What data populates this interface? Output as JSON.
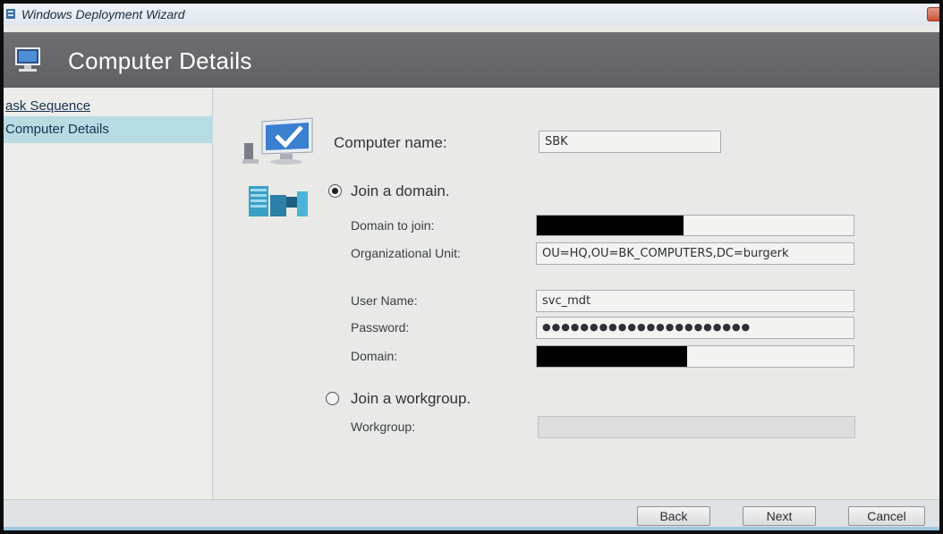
{
  "window": {
    "title": "Windows Deployment Wizard"
  },
  "header": {
    "title": "Computer Details"
  },
  "sidebar": {
    "items": [
      {
        "label": "ask Sequence"
      },
      {
        "label": "Computer Details"
      }
    ]
  },
  "form": {
    "computer_name": {
      "label": "Computer name:",
      "value": "SBK"
    },
    "join_domain": {
      "label": "Join a domain.",
      "selected": true,
      "domain_to_join": {
        "label": "Domain to join:",
        "value": ""
      },
      "organizational_unit": {
        "label": "Organizational Unit:",
        "value": "OU=HQ,OU=BK_COMPUTERS,DC=burgerk"
      },
      "user_name": {
        "label": "User Name:",
        "value": "svc_mdt"
      },
      "password": {
        "label": "Password:",
        "value": "●●●●●●●●●●●●●●●●●●●●●●"
      },
      "domain": {
        "label": "Domain:",
        "value": ""
      }
    },
    "join_workgroup": {
      "label": "Join a workgroup.",
      "selected": false,
      "workgroup": {
        "label": "Workgroup:",
        "value": ""
      }
    }
  },
  "buttons": {
    "back": "Back",
    "next": "Next",
    "cancel": "Cancel"
  },
  "colors": {
    "header_bg": "#656669",
    "nav_selected": "#b8dce3",
    "accent": "#9fc4dd"
  },
  "icons": {
    "app": "wizard-icon",
    "header": "computer-icon",
    "computer": "computer-check-icon",
    "domain": "server-tower-icon"
  }
}
